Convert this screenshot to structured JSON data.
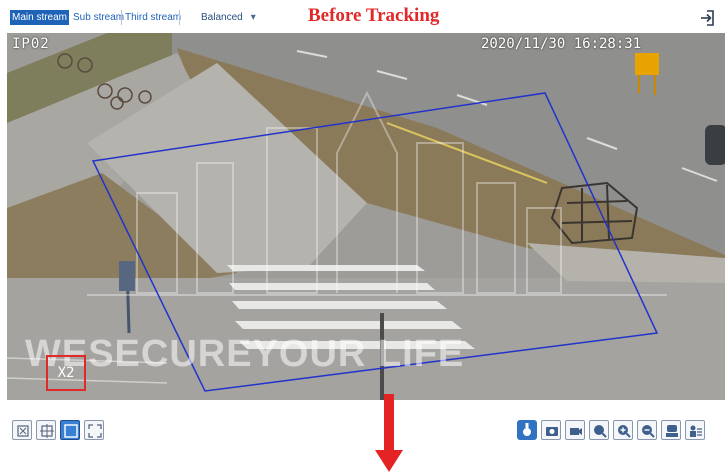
{
  "stream_tabs": [
    {
      "label": "Main stream",
      "active": true
    },
    {
      "label": "Sub stream",
      "active": false
    },
    {
      "label": "Third stream",
      "active": false
    }
  ],
  "quality": {
    "label": "Balanced",
    "caret": "▾"
  },
  "title": "Before Tracking",
  "camera": {
    "name": "IP02",
    "timestamp": "2020/11/30  16:28:31"
  },
  "zoom_label": "X2",
  "watermark": "WESECUREYOUR LIFE",
  "colors": {
    "accent": "#1f63b8",
    "title": "#e32828",
    "tracking_region": "#2233cc",
    "zoom_box": "#e02a2a",
    "arrow": "#e42424"
  },
  "icons": {
    "exit": "exit-icon",
    "left_toolbar": [
      "fit-window-icon",
      "original-size-icon",
      "stretch-icon",
      "fullscreen-icon"
    ],
    "right_toolbar": [
      "tracking-icon",
      "snapshot-icon",
      "record-icon",
      "3d-zoom-icon",
      "zoom-in-icon",
      "zoom-out-icon",
      "ptz-icon",
      "settings-icon"
    ]
  }
}
